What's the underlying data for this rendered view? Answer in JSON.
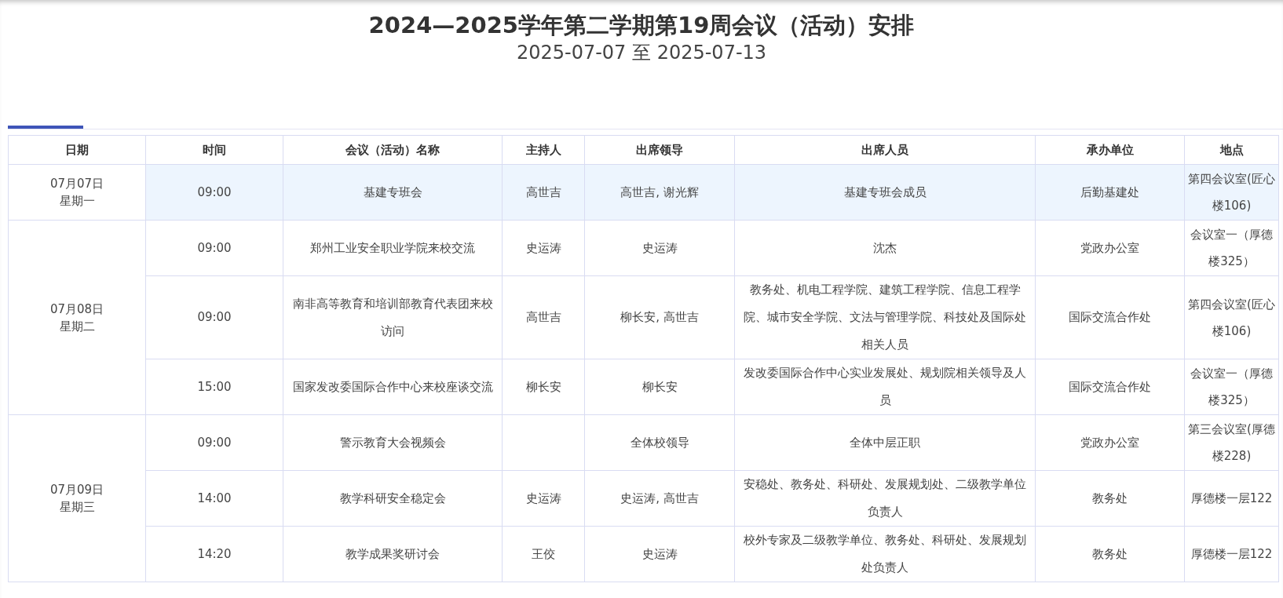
{
  "title": "2024—2025学年第二学期第19周会议（活动）安排",
  "date_range": "2025-07-07 至 2025-07-13",
  "table": {
    "columns": [
      "日期",
      "时间",
      "会议（活动）名称",
      "主持人",
      "出席领导",
      "出席人员",
      "承办单位",
      "地点"
    ],
    "days": [
      {
        "date": "07月07日",
        "weekday": "星期一",
        "meetings": [
          {
            "time": "09:00",
            "name": "基建专班会",
            "host": "高世吉",
            "leaders": "高世吉, 谢光辉",
            "attendees": "基建专班会成员",
            "organizer": "后勤基建处",
            "location": "第四会议室(匠心楼106)",
            "selected": true
          }
        ]
      },
      {
        "date": "07月08日",
        "weekday": "星期二",
        "meetings": [
          {
            "time": "09:00",
            "name": "郑州工业安全职业学院来校交流",
            "host": "史运涛",
            "leaders": "史运涛",
            "attendees": "沈杰",
            "organizer": "党政办公室",
            "location": "会议室一（厚德楼325）",
            "selected": false
          },
          {
            "time": "09:00",
            "name": "南非高等教育和培训部教育代表团来校访问",
            "host": "高世吉",
            "leaders": "柳长安, 高世吉",
            "attendees": "教务处、机电工程学院、建筑工程学院、信息工程学院、城市安全学院、文法与管理学院、科技处及国际处相关人员",
            "organizer": "国际交流合作处",
            "location": "第四会议室(匠心楼106)",
            "selected": false
          },
          {
            "time": "15:00",
            "name": "国家发改委国际合作中心来校座谈交流",
            "host": "柳长安",
            "leaders": "柳长安",
            "attendees": "发改委国际合作中心实业发展处、规划院相关领导及人员",
            "organizer": "国际交流合作处",
            "location": "会议室一（厚德楼325）",
            "selected": false
          }
        ]
      },
      {
        "date": "07月09日",
        "weekday": "星期三",
        "meetings": [
          {
            "time": "09:00",
            "name": "警示教育大会视频会",
            "leaders": "全体校领导",
            "attendees": "全体中层正职",
            "organizer": "党政办公室",
            "location": "第三会议室(厚德楼228)",
            "selected": false
          },
          {
            "time": "14:00",
            "name": "教学科研安全稳定会",
            "host": "史运涛",
            "leaders": "史运涛, 高世吉",
            "attendees": "安稳处、教务处、科研处、发展规划处、二级教学单位负责人",
            "organizer": "教务处",
            "location": "厚德楼一层122",
            "selected": false
          },
          {
            "time": "14:20",
            "name": "教学成果奖研讨会",
            "host": "王佼",
            "leaders": "史运涛",
            "attendees": "校外专家及二级教学单位、教务处、科研处、发展规划处负责人",
            "organizer": "教务处",
            "location": "厚德楼一层122",
            "selected": false
          }
        ]
      }
    ]
  }
}
